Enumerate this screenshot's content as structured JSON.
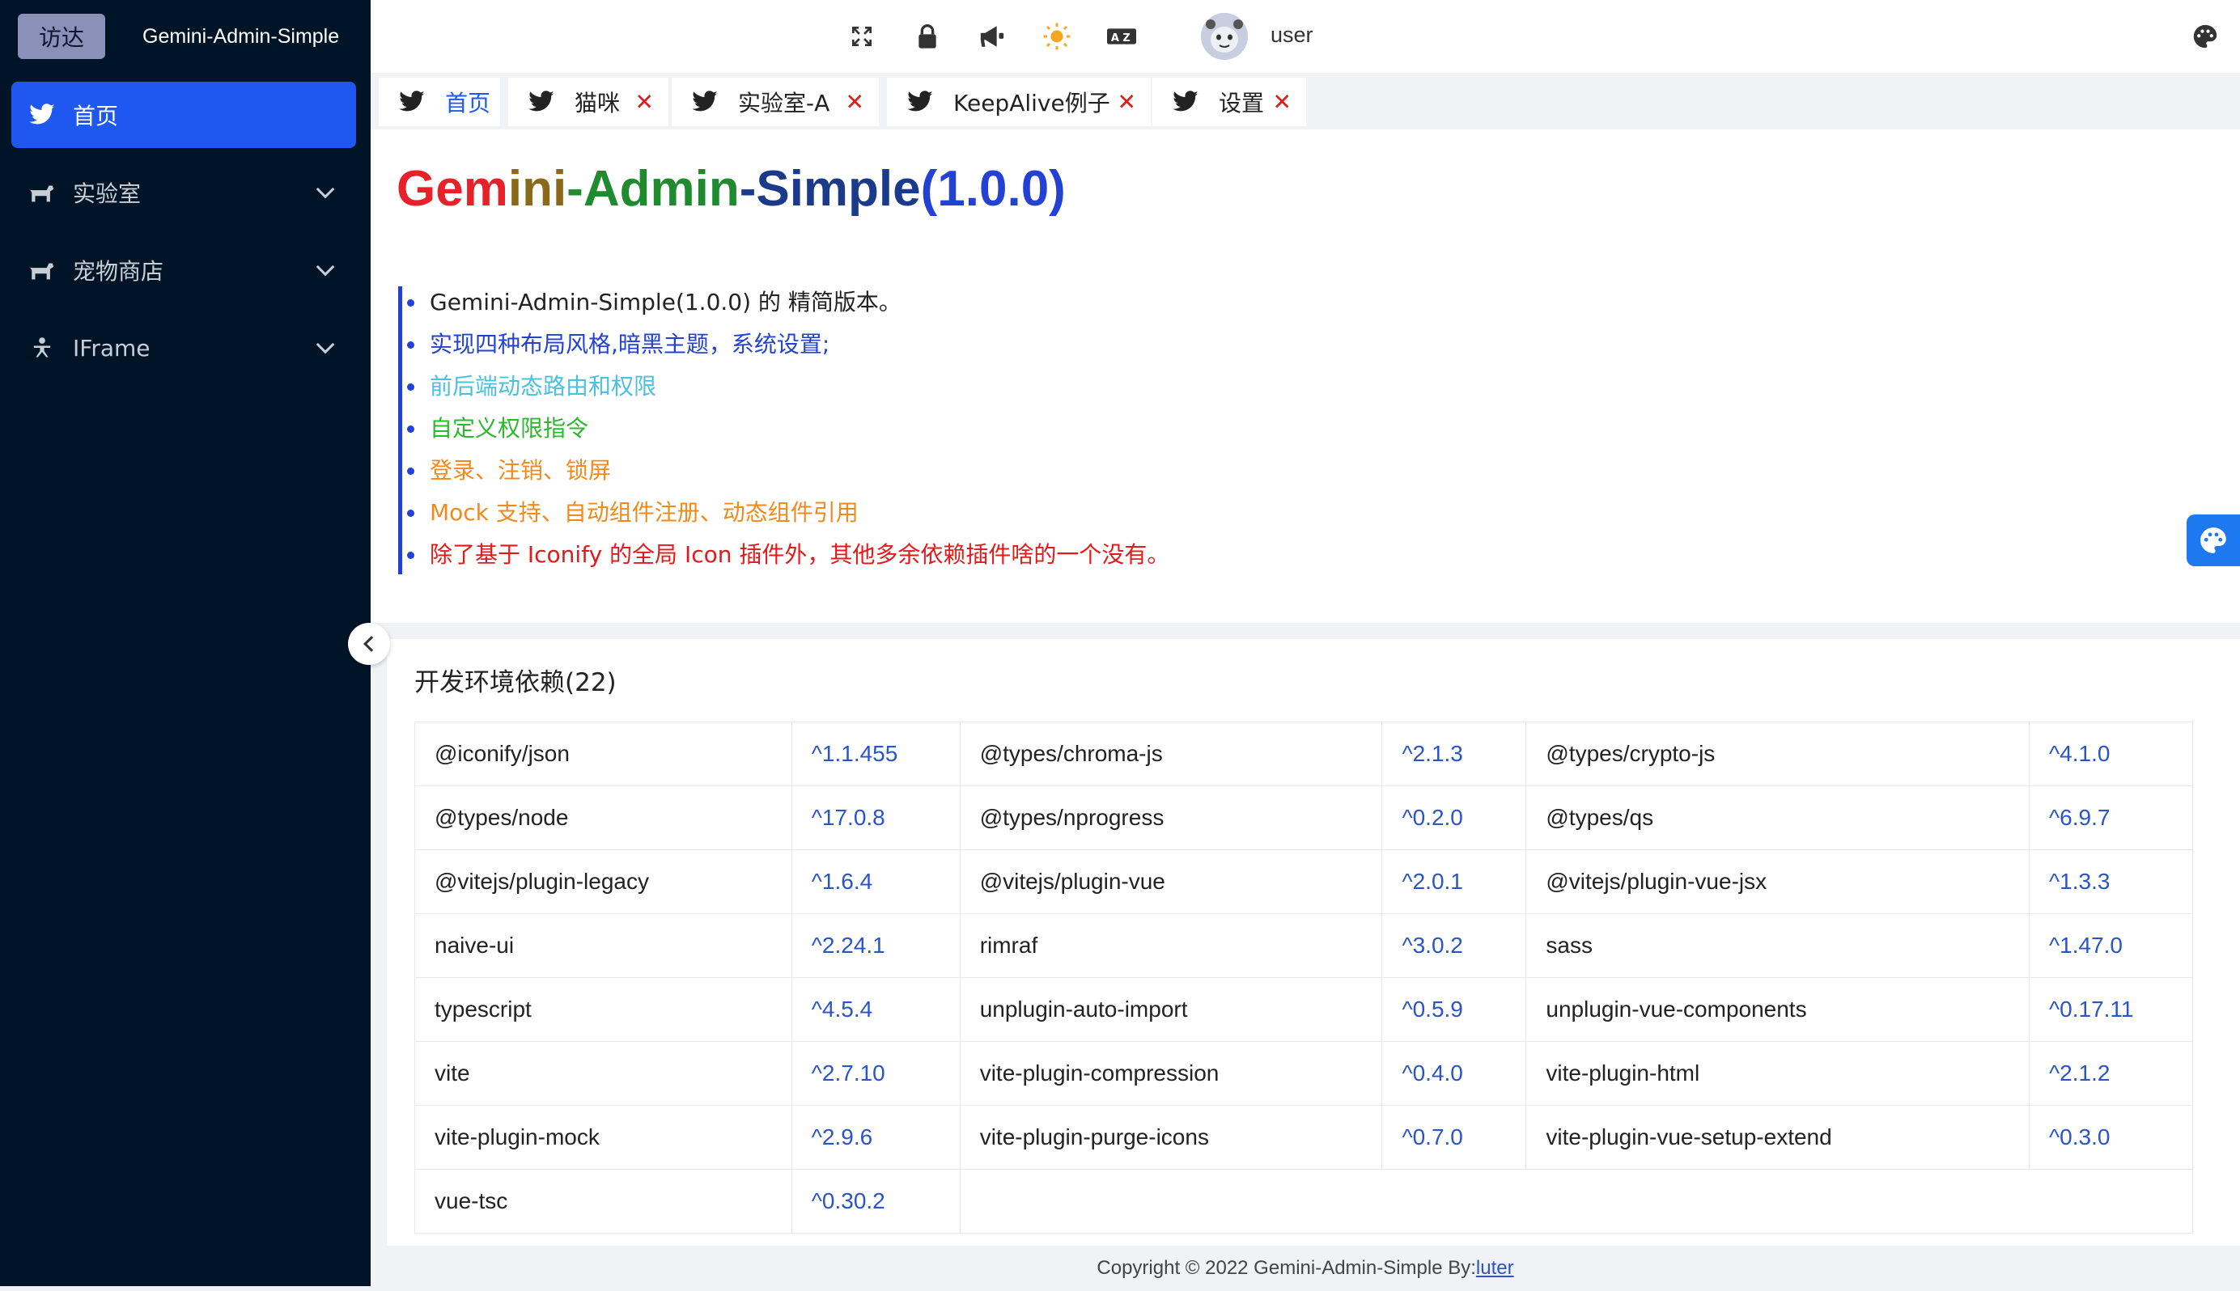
{
  "sidebar": {
    "tag": "访达",
    "app_name": "Gemini-Admin-Simple",
    "items": [
      {
        "label": "首页",
        "icon": "bird-icon",
        "active": true
      },
      {
        "label": "实验室",
        "icon": "pet-icon",
        "active": false
      },
      {
        "label": "宠物商店",
        "icon": "pet-icon",
        "active": false
      },
      {
        "label": "IFrame",
        "icon": "person-icon",
        "active": false
      }
    ]
  },
  "header": {
    "icons": [
      "fullscreen-icon",
      "lock-icon",
      "megaphone-icon",
      "sun-icon",
      "translate-icon",
      "palette-icon"
    ],
    "username": "user"
  },
  "tabs": [
    {
      "label": "首页",
      "active": true,
      "closable": false
    },
    {
      "label": "猫咪",
      "active": false,
      "closable": true
    },
    {
      "label": "实验室-A",
      "active": false,
      "closable": true
    },
    {
      "label": "KeepAlive例子",
      "active": false,
      "closable": true
    },
    {
      "label": "设置",
      "active": false,
      "closable": true
    }
  ],
  "close_glyph": "✕",
  "intro": {
    "title_parts": [
      {
        "text": "Gem",
        "color": "#e8202a"
      },
      {
        "text": "ini",
        "color": "#8a6a1a"
      },
      {
        "text": "-Admin",
        "color": "#1f8a2e"
      },
      {
        "text": "-Simple",
        "color": "#1b3a8a"
      },
      {
        "text": "(1.0.0)",
        "color": "#2342d4"
      }
    ],
    "features": [
      {
        "text": "Gemini-Admin-Simple(1.0.0) 的 精简版本。",
        "color": "#222222"
      },
      {
        "text": "实现四种布局风格,暗黑主题，系统设置;",
        "color": "#2342d4"
      },
      {
        "text": "前后端动态路由和权限",
        "color": "#4cc0e0"
      },
      {
        "text": "自定义权限指令",
        "color": "#2eb82e"
      },
      {
        "text": "登录、注销、锁屏",
        "color": "#f08a1a"
      },
      {
        "text": "Mock 支持、自动组件注册、动态组件引用",
        "color": "#f08a1a"
      },
      {
        "text": "除了基于 Iconify 的全局 Icon 插件外，其他多余依赖插件啥的一个没有。",
        "color": "#e21a1a"
      }
    ]
  },
  "deps": {
    "title": "开发环境依赖(22)",
    "rows": [
      [
        [
          "@iconify/json",
          "^1.1.455"
        ],
        [
          "@types/chroma-js",
          "^2.1.3"
        ],
        [
          "@types/crypto-js",
          "^4.1.0"
        ]
      ],
      [
        [
          "@types/node",
          "^17.0.8"
        ],
        [
          "@types/nprogress",
          "^0.2.0"
        ],
        [
          "@types/qs",
          "^6.9.7"
        ]
      ],
      [
        [
          "@vitejs/plugin-legacy",
          "^1.6.4"
        ],
        [
          "@vitejs/plugin-vue",
          "^2.0.1"
        ],
        [
          "@vitejs/plugin-vue-jsx",
          "^1.3.3"
        ]
      ],
      [
        [
          "naive-ui",
          "^2.24.1"
        ],
        [
          "rimraf",
          "^3.0.2"
        ],
        [
          "sass",
          "^1.47.0"
        ]
      ],
      [
        [
          "typescript",
          "^4.5.4"
        ],
        [
          "unplugin-auto-import",
          "^0.5.9"
        ],
        [
          "unplugin-vue-components",
          "^0.17.11"
        ]
      ],
      [
        [
          "vite",
          "^2.7.10"
        ],
        [
          "vite-plugin-compression",
          "^0.4.0"
        ],
        [
          "vite-plugin-html",
          "^2.1.2"
        ]
      ],
      [
        [
          "vite-plugin-mock",
          "^2.9.6"
        ],
        [
          "vite-plugin-purge-icons",
          "^0.7.0"
        ],
        [
          "vite-plugin-vue-setup-extend",
          "^0.3.0"
        ]
      ],
      [
        [
          "vue-tsc",
          "^0.30.2"
        ]
      ]
    ]
  },
  "footer": {
    "text": "Copyright © 2022 Gemini-Admin-Simple By:",
    "link": "luter"
  }
}
